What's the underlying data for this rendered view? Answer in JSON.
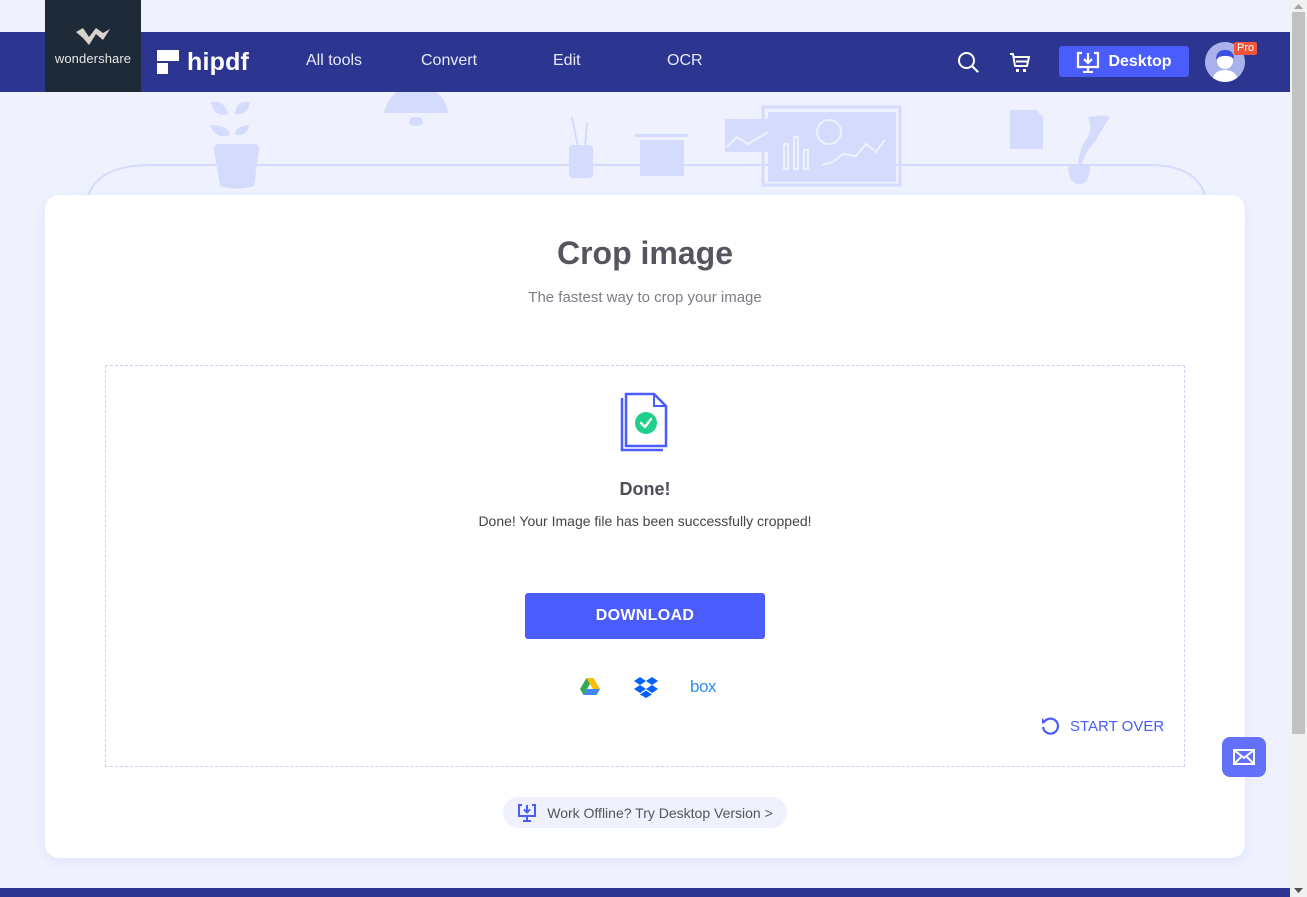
{
  "header": {
    "brand_parent": "wondershare",
    "brand": "hipdf",
    "nav": [
      {
        "label": "All tools"
      },
      {
        "label": "Convert"
      },
      {
        "label": "Edit"
      },
      {
        "label": "OCR"
      }
    ],
    "search_icon": "search-icon",
    "cart_icon": "cart-icon",
    "desktop_button": "Desktop",
    "pro_badge": "Pro"
  },
  "main": {
    "title": "Crop image",
    "subtitle": "The fastest way to crop your image",
    "status_title": "Done!",
    "status_message": "Done! Your Image file has been successfully cropped!",
    "download_button": "DOWNLOAD",
    "cloud_options": [
      {
        "name": "Google Drive",
        "icon": "google-drive-icon"
      },
      {
        "name": "Dropbox",
        "icon": "dropbox-icon"
      },
      {
        "name": "Box",
        "icon": "box-icon",
        "label": "box"
      }
    ],
    "start_over": "START OVER",
    "offline_prompt": "Work Offline? Try Desktop Version >"
  },
  "colors": {
    "header_bg": "#2c358f",
    "accent": "#4a5cfb",
    "success": "#1fd08a",
    "page_bg": "#eff2fe"
  }
}
